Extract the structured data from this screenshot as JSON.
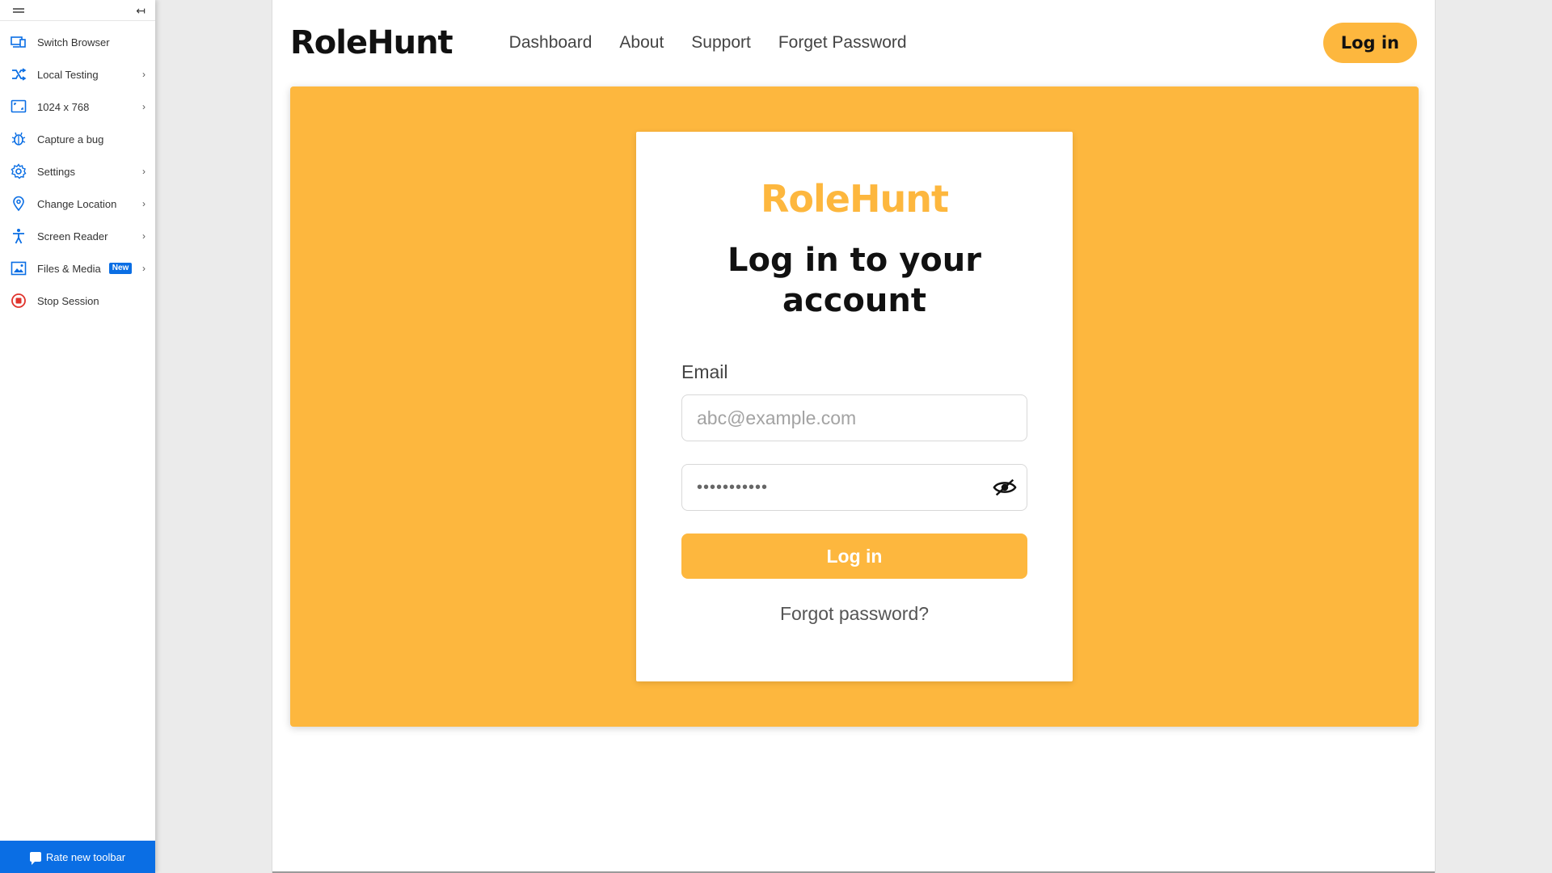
{
  "toolbar": {
    "collapse_glyph": "↤",
    "items": [
      {
        "label": "Switch Browser",
        "icon": "switch-browser-icon"
      },
      {
        "label": "Local Testing",
        "icon": "local-testing-icon"
      },
      {
        "label": "1024 x 768",
        "icon": "resolution-icon"
      },
      {
        "label": "Capture a bug",
        "icon": "bug-icon"
      },
      {
        "label": "Settings",
        "icon": "gear-icon"
      },
      {
        "label": "Change Location",
        "icon": "location-pin-icon"
      },
      {
        "label": "Screen Reader",
        "icon": "accessibility-icon"
      },
      {
        "label": "Files & Media",
        "icon": "image-icon",
        "badge": "New"
      },
      {
        "label": "Stop Session",
        "icon": "stop-icon"
      }
    ],
    "chevron": "›",
    "rate_label": "Rate new toolbar"
  },
  "site": {
    "brand": "RoleHunt",
    "nav": [
      "Dashboard",
      "About",
      "Support",
      "Forget Password"
    ],
    "login_button": "Log in"
  },
  "card": {
    "brand": "RoleHunt",
    "title": "Log in to your account",
    "email_label": "Email",
    "email_placeholder": "abc@example.com",
    "password_value": "•••••••••••",
    "submit_label": "Log in",
    "forgot_link": "Forgot password?"
  },
  "colors": {
    "accent": "#fdb73e",
    "toolbar_blue": "#0a6ee4",
    "stop_red": "#e0332c"
  }
}
